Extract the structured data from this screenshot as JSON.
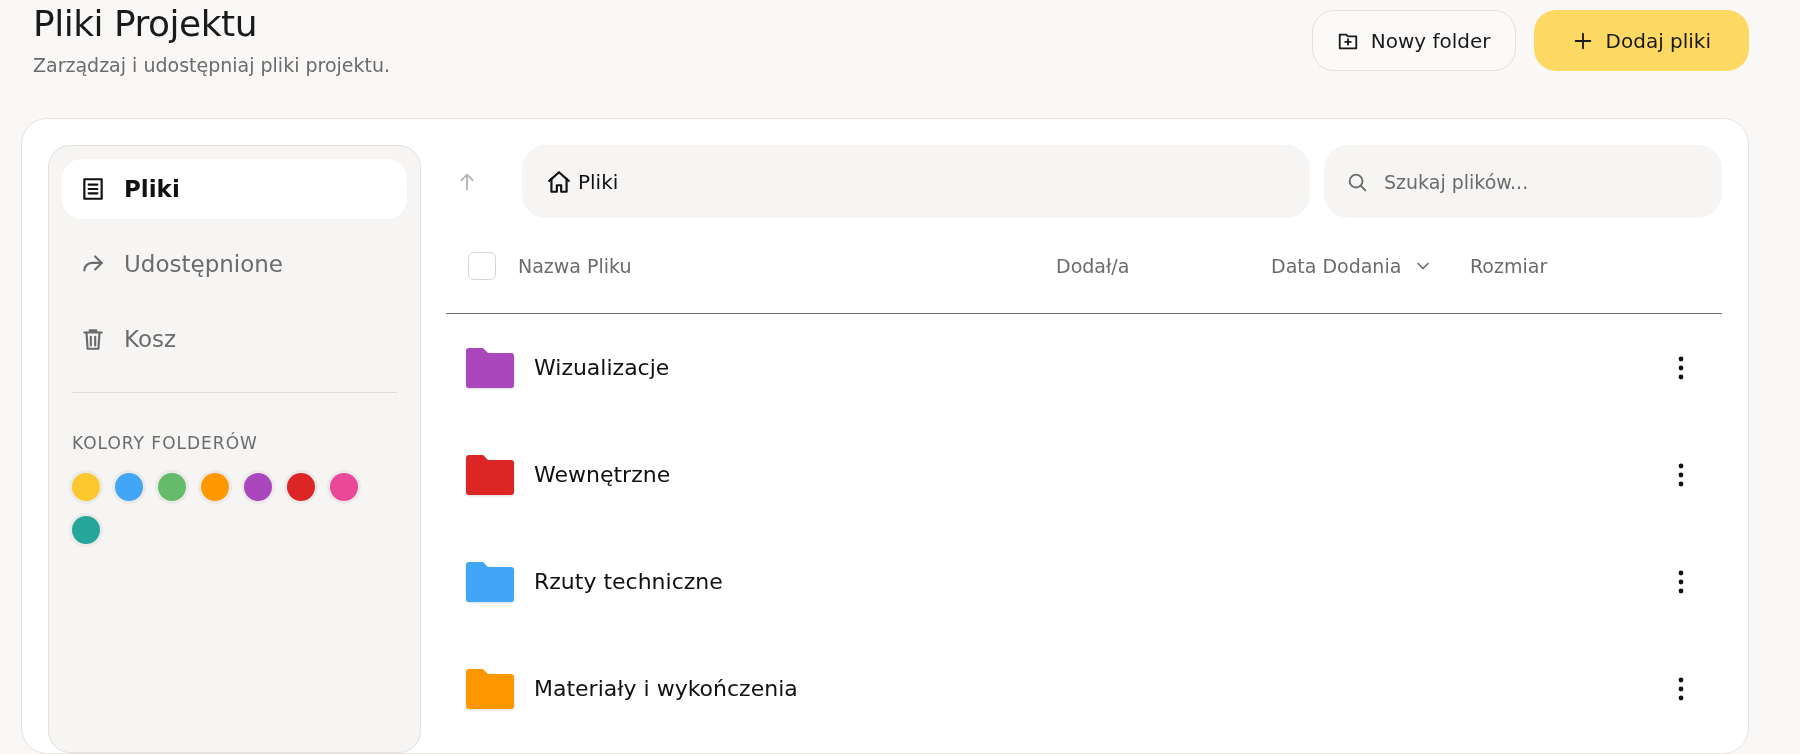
{
  "header": {
    "title": "Pliki Projektu",
    "subtitle": "Zarządzaj i udostępniaj pliki projektu.",
    "buttons": [
      {
        "kind": "secondary",
        "label": "Nowy folder"
      },
      {
        "kind": "primary",
        "label": "Dodaj pliki"
      }
    ]
  },
  "sidebar": {
    "items": [
      {
        "kind": "files",
        "label": "Pliki",
        "selected": true
      },
      {
        "kind": "shared",
        "label": "Udostępnione",
        "selected": false
      },
      {
        "kind": "trash",
        "label": "Kosz",
        "selected": false
      }
    ],
    "colors_heading": "KOLORY FOLDERÓW",
    "colors": [
      {
        "color": "#fbc82d"
      },
      {
        "color": "#42a5f5"
      },
      {
        "color": "#66bb6a"
      },
      {
        "color": "#ff9800"
      },
      {
        "color": "#ab47bc"
      },
      {
        "color": "#dc2626"
      },
      {
        "color": "#ec4899"
      },
      {
        "color": "#26a69a"
      }
    ]
  },
  "breadcrumb": {
    "label": "Pliki"
  },
  "search": {
    "placeholder": "Szukaj plików..."
  },
  "table": {
    "select_all": {
      "checked": false
    },
    "columns": [
      {
        "label": "Nazwa Pliku",
        "sorted": false
      },
      {
        "label": "Dodał/a",
        "sorted": false
      },
      {
        "label": "Data Dodania",
        "sorted": true
      },
      {
        "label": "Rozmiar",
        "sorted": false
      }
    ],
    "rows": [
      {
        "name": "Wizualizacje",
        "color": "#ab47bc"
      },
      {
        "name": "Wewnętrzne",
        "color": "#dc2626"
      },
      {
        "name": "Rzuty techniczne",
        "color": "#42a5f5"
      },
      {
        "name": "Materiały i wykończenia",
        "color": "#ff9800"
      }
    ]
  }
}
